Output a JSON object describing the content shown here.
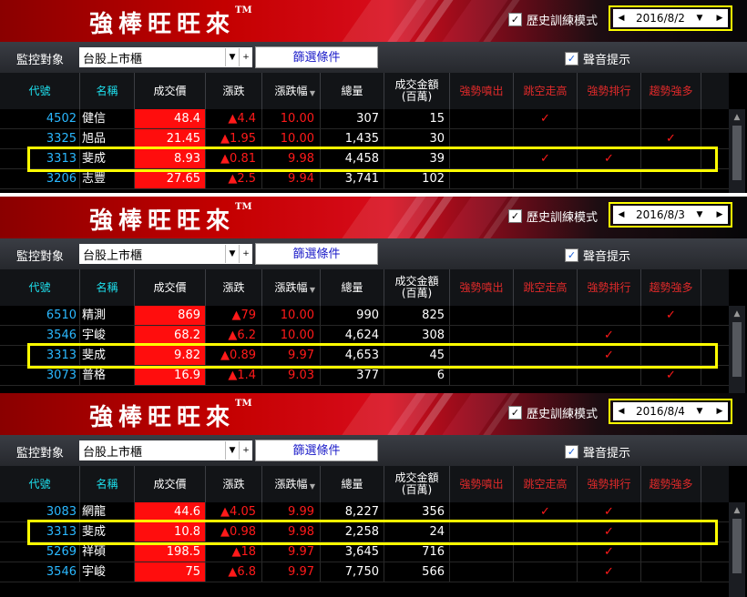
{
  "app": {
    "brand": "強棒旺旺來",
    "trademark": "TM"
  },
  "labels": {
    "history_mode": "歷史訓練模式",
    "monitor_label": "監控對象",
    "market_select": "台股上市櫃",
    "filter_button": "篩選條件",
    "sound_alert": "聲音提示",
    "checkmark": "✓",
    "dropdown_glyph": "▼",
    "plus_glyph": "+",
    "prev_glyph": "◀",
    "next_glyph": "▶",
    "scroll_up_glyph": "▲",
    "sort_glyph": "▼"
  },
  "columns": [
    {
      "label": "代號",
      "color": "cyan"
    },
    {
      "label": "名稱",
      "color": "cyan"
    },
    {
      "label": "成交價",
      "color": "white"
    },
    {
      "label": "漲跌",
      "color": "white"
    },
    {
      "label": "漲跌幅",
      "color": "white"
    },
    {
      "label": "總量",
      "color": "white"
    },
    {
      "label": "成交金額(百萬)",
      "color": "white"
    },
    {
      "label": "強勢噴出",
      "color": "red"
    },
    {
      "label": "跳空走高",
      "color": "red"
    },
    {
      "label": "強勢排行",
      "color": "red"
    },
    {
      "label": "趨勢強多",
      "color": "red"
    }
  ],
  "colors": {
    "highlight": "#ffff00",
    "up_red": "#ff1a1a",
    "price_bg": "#ff0d0d",
    "code_blue": "#2ab8ff"
  },
  "panels": [
    {
      "date": "2016/8/2",
      "rows": [
        {
          "code": "4502",
          "name": "健信",
          "price": "48.4",
          "change": "▲4.4",
          "pct": "10.00",
          "volume": "307",
          "amount": "15",
          "s1": "",
          "s2": "✓",
          "s3": "",
          "s4": ""
        },
        {
          "code": "3325",
          "name": "旭品",
          "price": "21.45",
          "change": "▲1.95",
          "pct": "10.00",
          "volume": "1,435",
          "amount": "30",
          "s1": "",
          "s2": "",
          "s3": "",
          "s4": "✓"
        },
        {
          "code": "3313",
          "name": "斐成",
          "price": "8.93",
          "change": "▲0.81",
          "pct": "9.98",
          "volume": "4,458",
          "amount": "39",
          "s1": "",
          "s2": "✓",
          "s3": "✓",
          "s4": ""
        },
        {
          "code": "3206",
          "name": "志豐",
          "price": "27.65",
          "change": "▲2.5",
          "pct": "9.94",
          "volume": "3,741",
          "amount": "102",
          "s1": "",
          "s2": "",
          "s3": "",
          "s4": ""
        }
      ]
    },
    {
      "date": "2016/8/3",
      "rows": [
        {
          "code": "6510",
          "name": "精測",
          "price": "869",
          "change": "▲79",
          "pct": "10.00",
          "volume": "990",
          "amount": "825",
          "s1": "",
          "s2": "",
          "s3": "",
          "s4": "✓"
        },
        {
          "code": "3546",
          "name": "宇峻",
          "price": "68.2",
          "change": "▲6.2",
          "pct": "10.00",
          "volume": "4,624",
          "amount": "308",
          "s1": "",
          "s2": "",
          "s3": "✓",
          "s4": ""
        },
        {
          "code": "3313",
          "name": "斐成",
          "price": "9.82",
          "change": "▲0.89",
          "pct": "9.97",
          "volume": "4,653",
          "amount": "45",
          "s1": "",
          "s2": "",
          "s3": "✓",
          "s4": ""
        },
        {
          "code": "3073",
          "name": "普格",
          "price": "16.9",
          "change": "▲1.4",
          "pct": "9.03",
          "volume": "377",
          "amount": "6",
          "s1": "",
          "s2": "",
          "s3": "",
          "s4": "✓"
        }
      ]
    },
    {
      "date": "2016/8/4",
      "rows": [
        {
          "code": "3083",
          "name": "網龍",
          "price": "44.6",
          "change": "▲4.05",
          "pct": "9.99",
          "volume": "8,227",
          "amount": "356",
          "s1": "",
          "s2": "✓",
          "s3": "✓",
          "s4": ""
        },
        {
          "code": "3313",
          "name": "斐成",
          "price": "10.8",
          "change": "▲0.98",
          "pct": "9.98",
          "volume": "2,258",
          "amount": "24",
          "s1": "",
          "s2": "",
          "s3": "✓",
          "s4": ""
        },
        {
          "code": "5269",
          "name": "祥碩",
          "price": "198.5",
          "change": "▲18",
          "pct": "9.97",
          "volume": "3,645",
          "amount": "716",
          "s1": "",
          "s2": "",
          "s3": "✓",
          "s4": ""
        },
        {
          "code": "3546",
          "name": "宇峻",
          "price": "75",
          "change": "▲6.8",
          "pct": "9.97",
          "volume": "7,750",
          "amount": "566",
          "s1": "",
          "s2": "",
          "s3": "✓",
          "s4": ""
        }
      ]
    }
  ]
}
